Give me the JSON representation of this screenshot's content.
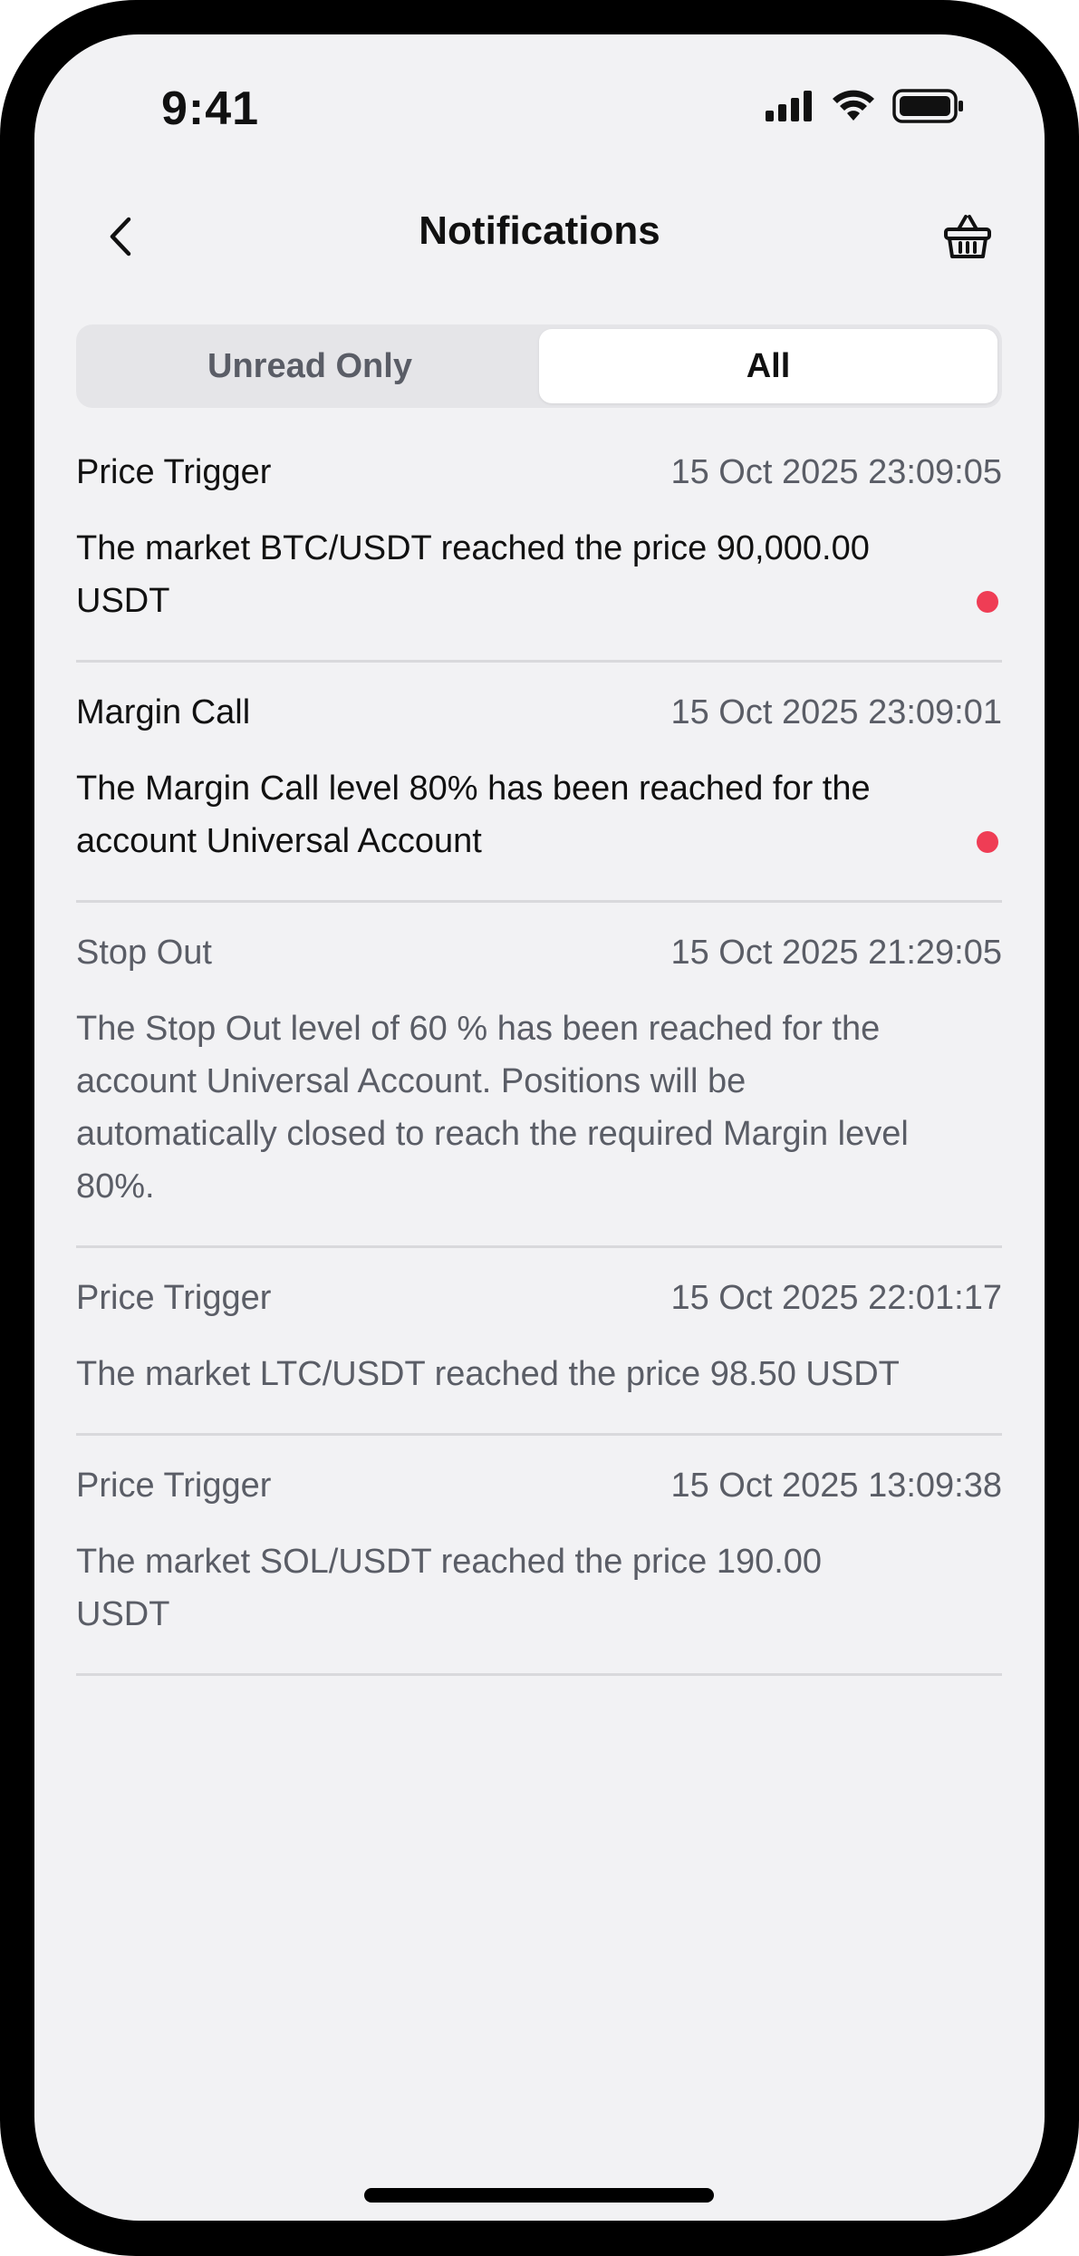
{
  "status_bar": {
    "time": "9:41",
    "icons": [
      "cellular-signal-icon",
      "wifi-icon",
      "battery-icon"
    ]
  },
  "header": {
    "title": "Notifications",
    "back_icon": "chevron-left-icon",
    "action_icon": "basket-icon"
  },
  "filter": {
    "options": [
      "Unread Only",
      "All"
    ],
    "selected": "All"
  },
  "notifications": [
    {
      "type": "Price Trigger",
      "time": "15 Oct 2025 23:09:05",
      "message": "The market BTC/USDT reached the price 90,000.00 USDT",
      "unread": true
    },
    {
      "type": "Margin Call",
      "time": "15 Oct 2025 23:09:01",
      "message": "The Margin Call level 80% has been reached for the account Universal Account",
      "unread": true
    },
    {
      "type": "Stop Out",
      "time": "15 Oct 2025 21:29:05",
      "message": "The Stop Out level of 60 % has been reached for the account Universal Account. Positions will be automatically closed to reach the required Margin level 80%.",
      "unread": false
    },
    {
      "type": "Price Trigger",
      "time": "15 Oct 2025 22:01:17",
      "message": "The market LTC/USDT reached the price 98.50 USDT",
      "unread": false
    },
    {
      "type": "Price Trigger",
      "time": "15 Oct 2025 13:09:38",
      "message": "The market SOL/USDT reached the price 190.00 USDT",
      "unread": false
    }
  ],
  "colors": {
    "background": "#f2f2f4",
    "unread_dot": "#ef3d55",
    "primary_text": "#111111",
    "secondary_text": "#5a5d66",
    "divider": "#d9d9dc"
  }
}
